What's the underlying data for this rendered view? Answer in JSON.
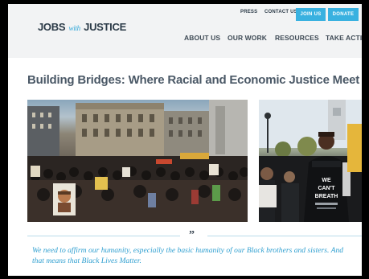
{
  "brand": {
    "logo_jobs": "JOBS",
    "logo_with": "with",
    "logo_justice": "JUSTICE"
  },
  "utility_nav": {
    "press": "PRESS",
    "contact": "CONTACT US",
    "join": "JOIN US",
    "donate": "DONATE"
  },
  "main_nav": [
    {
      "label": "ABOUT US"
    },
    {
      "label": "OUR WORK"
    },
    {
      "label": "RESOURCES"
    },
    {
      "label": "TAKE ACTION"
    }
  ],
  "article": {
    "title": "Building Bridges: Where Racial and Economic Justice Meet",
    "quote_mark": "”",
    "quote": "We need to affirm our humanity, especially the basic humanity of our Black brothers and sisters. And that means that Black Lives Matter.",
    "sign_text": "WE CAN'T BREATH"
  },
  "colors": {
    "accent": "#39b1e0",
    "quote": "#2f9fd0",
    "header_bg": "#f2f3f4",
    "nav_text": "#3e4a55"
  }
}
